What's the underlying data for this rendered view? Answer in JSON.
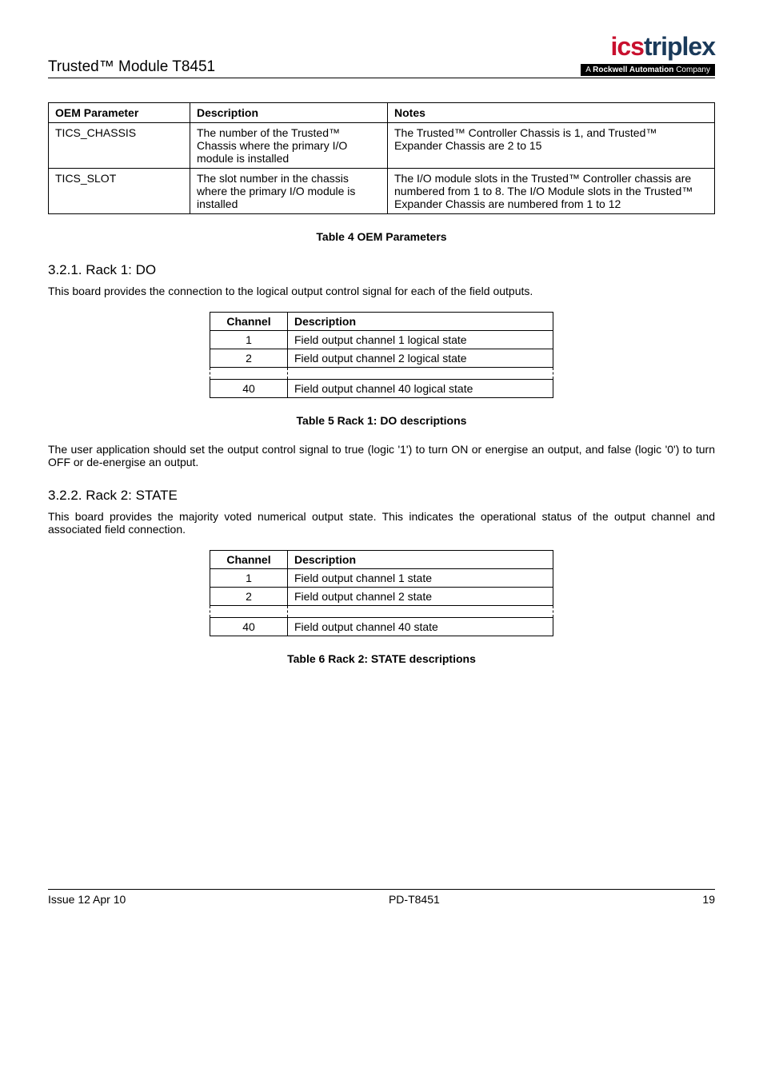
{
  "header": {
    "left": "Trusted™ Module T8451",
    "logo_main_1": "ics",
    "logo_main_2": "triplex",
    "logo_sub_pre": "A ",
    "logo_sub_bold": "Rockwell Automation",
    "logo_sub_post": " Company"
  },
  "oem_table": {
    "headers": [
      "OEM Parameter",
      "Description",
      "Notes"
    ],
    "rows": [
      {
        "param": "TICS_CHASSIS",
        "desc": "The number of the Trusted™ Chassis where the primary I/O module is installed",
        "notes": "The Trusted™ Controller Chassis is 1, and Trusted™ Expander Chassis are 2 to 15"
      },
      {
        "param": "TICS_SLOT",
        "desc": "The slot number in the chassis where the primary I/O module is installed",
        "notes": "The I/O module slots in the Trusted™ Controller chassis are numbered from 1 to 8. The I/O Module slots in the Trusted™ Expander Chassis are numbered from 1 to 12"
      }
    ]
  },
  "caption_oem": "Table 4 OEM Parameters",
  "section_321": {
    "heading": "3.2.1. Rack 1: DO",
    "intro": "This board provides the connection to the logical output control signal for each of the field outputs.",
    "table_headers": [
      "Channel",
      "Description"
    ],
    "rows": [
      {
        "ch": "1",
        "desc": "Field output channel 1 logical state"
      },
      {
        "ch": "2",
        "desc": "Field output channel 2 logical state"
      },
      {
        "ch": "40",
        "desc": "Field output channel 40 logical state"
      }
    ],
    "caption": "Table 5 Rack 1: DO descriptions",
    "followup": "The user application should set the output control signal to true (logic '1') to turn ON or energise an output, and false (logic '0') to turn OFF or de-energise an output."
  },
  "section_322": {
    "heading": "3.2.2. Rack 2: STATE",
    "intro": "This board provides the majority voted numerical output state.  This indicates the operational status of the output channel and associated field connection.",
    "table_headers": [
      "Channel",
      "Description"
    ],
    "rows": [
      {
        "ch": "1",
        "desc": "Field output channel 1 state"
      },
      {
        "ch": "2",
        "desc": "Field output channel 2 state"
      },
      {
        "ch": "40",
        "desc": "Field output channel 40 state"
      }
    ],
    "caption": "Table 6 Rack 2: STATE descriptions"
  },
  "footer": {
    "left": "Issue 12 Apr 10",
    "center": "PD-T8451",
    "right": "19"
  }
}
